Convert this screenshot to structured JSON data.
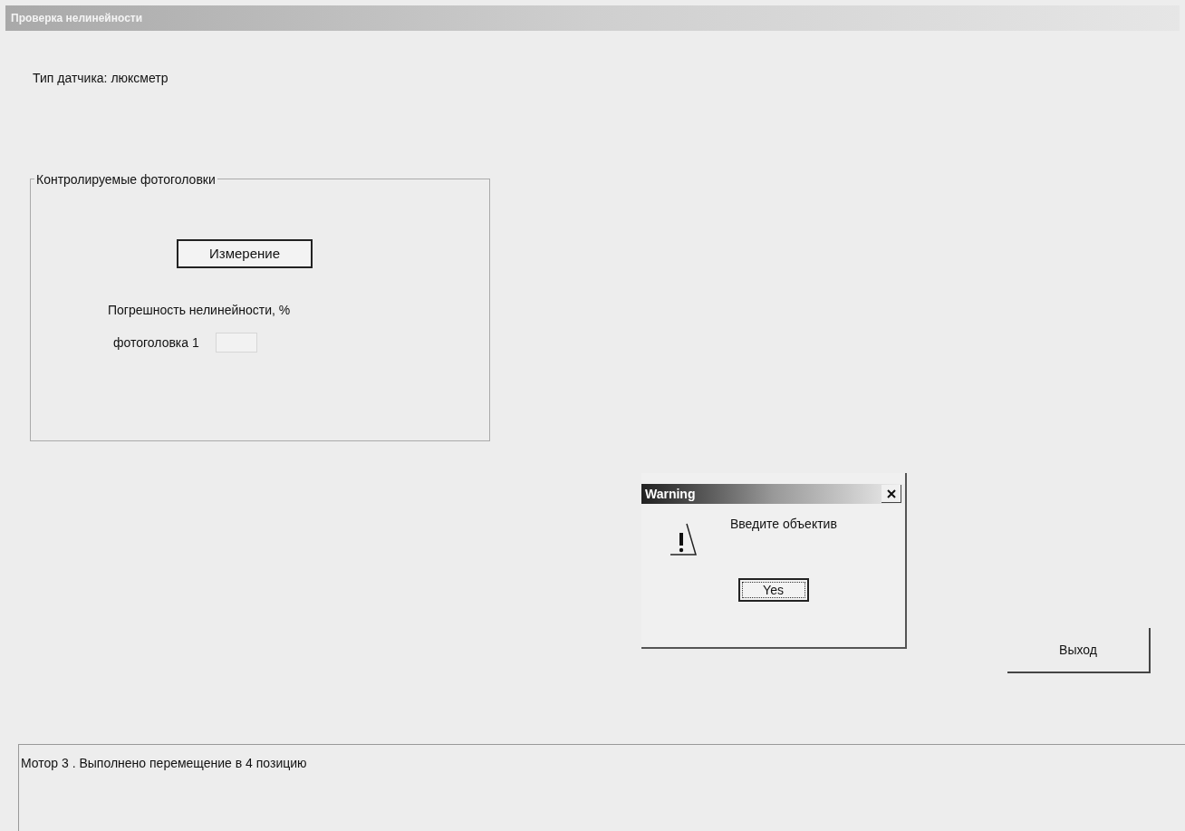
{
  "window": {
    "title": "Проверка нелинейности"
  },
  "sensor_type": "Тип датчика: люксметр",
  "group": {
    "title": "Контролируемые фотоголовки",
    "measure_button": "Измерение",
    "error_label": "Погрешность нелинейности, %",
    "rows": [
      {
        "label": "фотоголовка 1"
      }
    ]
  },
  "exit_button": "Выход",
  "status": {
    "message": "Мотор 3 . Выполнено перемещение в 4 позицию"
  },
  "dialog": {
    "title": "Warning",
    "message": "Введите объектив",
    "buttons": [
      {
        "label": "Yes",
        "selected": true
      }
    ]
  }
}
